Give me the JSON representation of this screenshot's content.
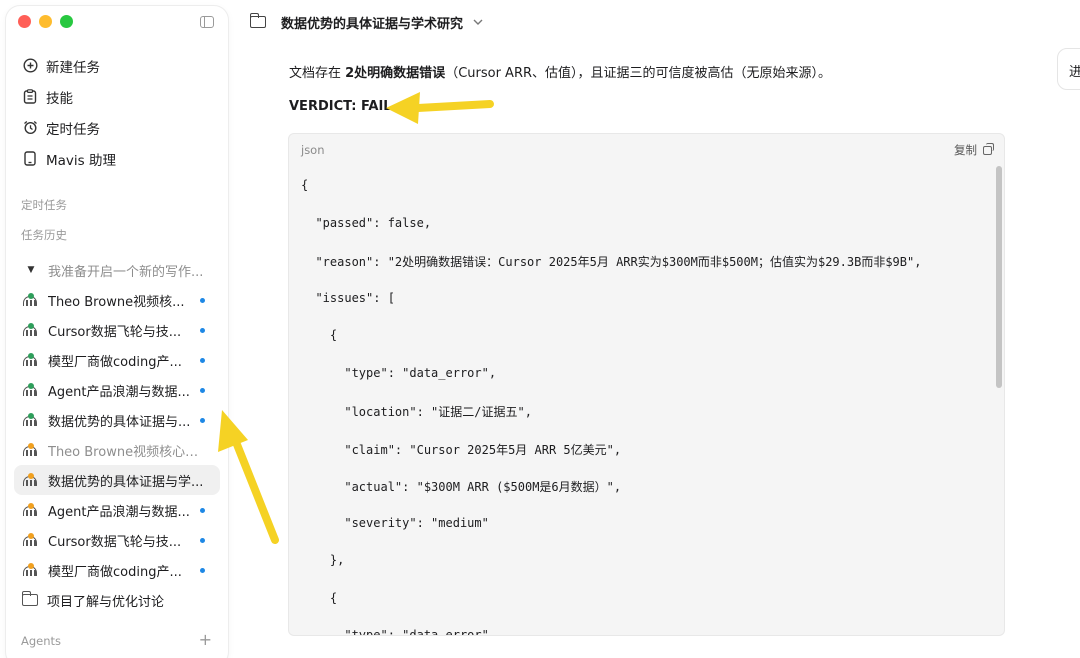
{
  "window": {
    "title": "数据优势的具体证据与学术研究"
  },
  "sidebar": {
    "nav": [
      {
        "label": "新建任务",
        "icon": "plus-circle-icon"
      },
      {
        "label": "技能",
        "icon": "clipboard-icon"
      },
      {
        "label": "定时任务",
        "icon": "alarm-clock-icon"
      },
      {
        "label": "Mavis 助理",
        "icon": "phone-icon"
      }
    ],
    "scheduled_label": "定时任务",
    "history_label": "任务历史",
    "history": [
      {
        "label": "我准备开启一个新的写作...",
        "type": "collapsed",
        "muted": true
      },
      {
        "label": "Theo Browne视频核...",
        "dot_color": "#2e9e5b",
        "unread": true
      },
      {
        "label": "Cursor数据飞轮与技...",
        "dot_color": "#2e9e5b",
        "unread": true
      },
      {
        "label": "模型厂商做coding产...",
        "dot_color": "#2e9e5b",
        "unread": true
      },
      {
        "label": "Agent产品浪潮与数据...",
        "dot_color": "#2e9e5b",
        "unread": true
      },
      {
        "label": "数据优势的具体证据与...",
        "dot_color": "#2e9e5b",
        "unread": true
      },
      {
        "label": "Theo Browne视频核心论...",
        "dot_color": "#f0a020",
        "unread": false,
        "muted": true
      },
      {
        "label": "数据优势的具体证据与学...",
        "dot_color": "#f0a020",
        "unread": false,
        "active": true
      },
      {
        "label": "Agent产品浪潮与数据...",
        "dot_color": "#f0a020",
        "unread": true
      },
      {
        "label": "Cursor数据飞轮与技...",
        "dot_color": "#f0a020",
        "unread": true
      },
      {
        "label": "模型厂商做coding产...",
        "dot_color": "#f0a020",
        "unread": true
      },
      {
        "label": "项目了解与优化讨论",
        "type": "folder"
      }
    ],
    "agents_label": "Agents",
    "agents_add": "+"
  },
  "header": {
    "title": "数据优势的具体证据与学术研究",
    "side_tab": "进"
  },
  "main": {
    "message_prefix": "文档存在 ",
    "message_bold": "2处明确数据错误",
    "message_suffix": "（Cursor ARR、估值），且证据三的可信度被高估（无原始来源）。",
    "verdict": "VERDICT: FAIL",
    "code": {
      "lang": "json",
      "copy_label": "复制",
      "lines": [
        "{",
        "  \"passed\": false,",
        "  \"reason\": \"2处明确数据错误：Cursor 2025年5月 ARR实为$300M而非$500M；估值实为$29.3B而非$9B\",",
        "  \"issues\": [",
        "    {",
        "      \"type\": \"data_error\",",
        "      \"location\": \"证据二/证据五\",",
        "      \"claim\": \"Cursor 2025年5月 ARR 5亿美元\",",
        "      \"actual\": \"$300M ARR ($500M是6月数据）\",",
        "      \"severity\": \"medium\"",
        "    },",
        "    {",
        "      \"type\": \"data_error\","
      ]
    }
  },
  "colors": {
    "arrow": "#f5d224",
    "unread_dot": "#1e88e5"
  }
}
